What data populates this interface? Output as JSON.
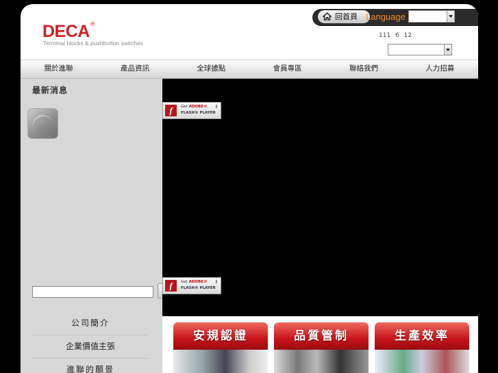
{
  "header": {
    "logo": "DECA",
    "logo_mark": "®",
    "tagline": "Terminal blocks & pushbutton switches",
    "home_label": "回首頁",
    "language_label": "Language",
    "date": "111 6 12"
  },
  "nav": {
    "items": [
      "關於進聯",
      "產品資訊",
      "全球據點",
      "會員專區",
      "聯絡我們",
      "人力招募"
    ]
  },
  "sidebar": {
    "news_title": "最新消息",
    "menu": [
      "公司簡介",
      "企業價值主張",
      "進聯的願景"
    ]
  },
  "flash": {
    "get": "Get",
    "adobe": "ADOBE®",
    "player": "FLASH® PLAYER"
  },
  "banners": [
    "安規認證",
    "品質管制",
    "生產效率"
  ],
  "colors": {
    "brand": "#d21f1f",
    "language": "#f28a2e",
    "banner_red": "#c8141b"
  }
}
